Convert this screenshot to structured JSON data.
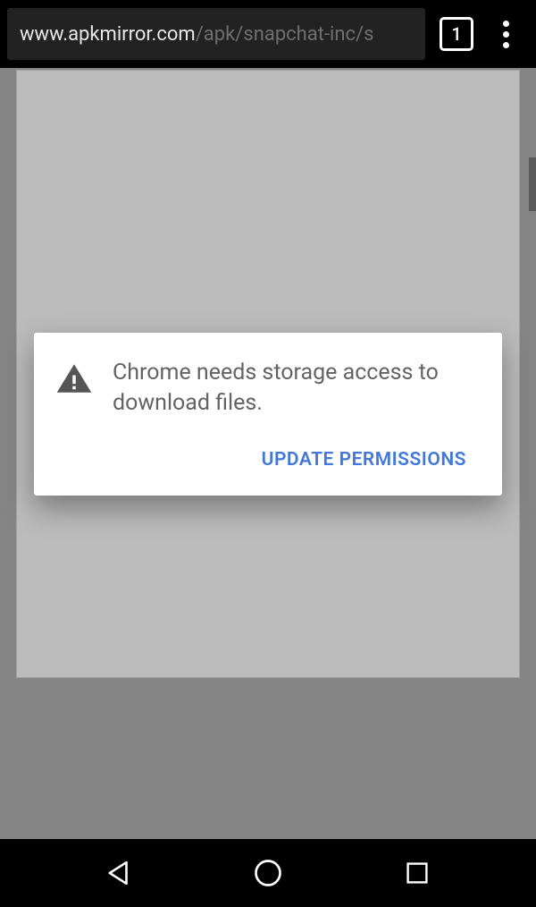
{
  "browser": {
    "url_host": "www.apkmirror.com",
    "url_path": "/apk/snapchat-inc/s",
    "tab_count": "1"
  },
  "dialog": {
    "message": "Chrome needs storage access to download files.",
    "action_label": "UPDATE PERMISSIONS"
  }
}
